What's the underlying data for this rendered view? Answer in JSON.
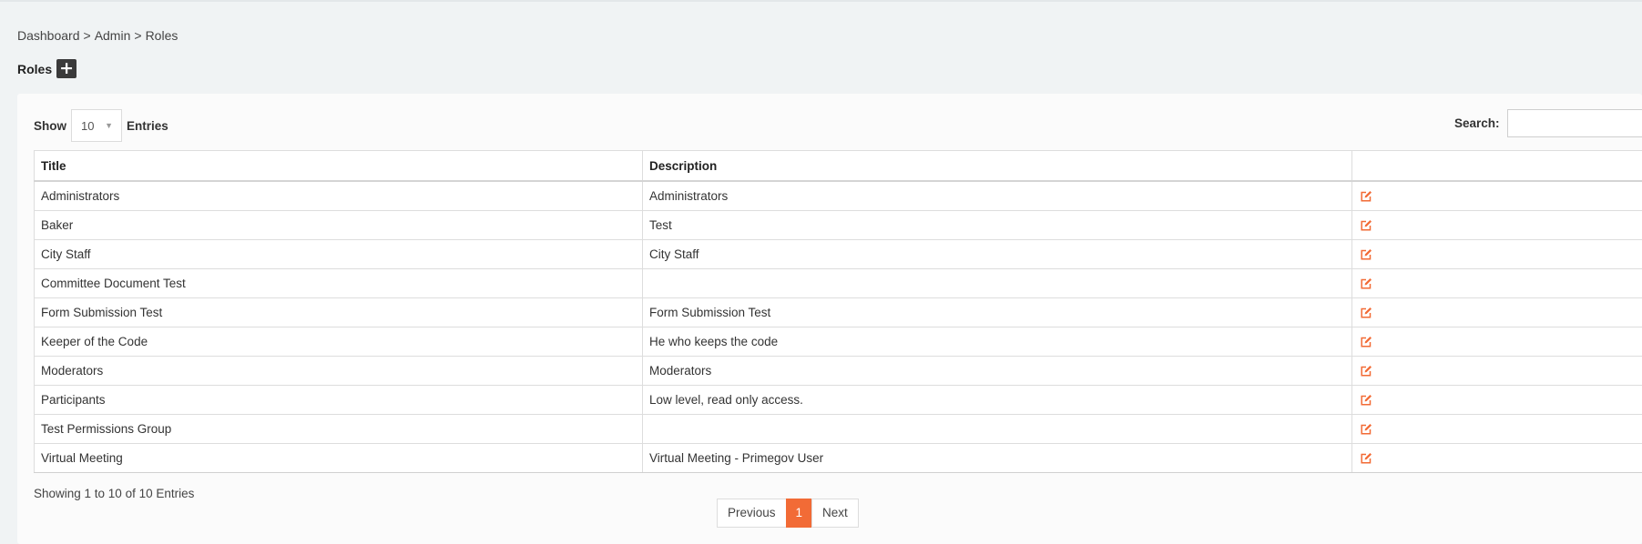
{
  "breadcrumb": {
    "items": [
      "Dashboard",
      "Admin",
      "Roles"
    ],
    "separator": ">"
  },
  "page": {
    "title": "Roles",
    "add_button_label": "+"
  },
  "table_controls": {
    "show_label": "Show",
    "entries_value": "10",
    "entries_label": "Entries",
    "search_label": "Search:",
    "search_value": ""
  },
  "table": {
    "columns": [
      "Title",
      "Description",
      ""
    ],
    "rows": [
      {
        "title": "Administrators",
        "description": "Administrators"
      },
      {
        "title": "Baker",
        "description": "Test"
      },
      {
        "title": "City Staff",
        "description": "City Staff"
      },
      {
        "title": "Committee Document Test",
        "description": ""
      },
      {
        "title": "Form Submission Test",
        "description": "Form Submission Test"
      },
      {
        "title": "Keeper of the Code",
        "description": "He who keeps the code"
      },
      {
        "title": "Moderators",
        "description": "Moderators"
      },
      {
        "title": "Participants",
        "description": "Low level, read only access."
      },
      {
        "title": "Test Permissions Group",
        "description": ""
      },
      {
        "title": "Virtual Meeting",
        "description": "Virtual Meeting - Primegov User"
      }
    ],
    "row_action_icon": "edit-icon"
  },
  "footer": {
    "info": "Showing 1 to 10 of 10 Entries",
    "pagination": {
      "previous_label": "Previous",
      "current_page": "1",
      "next_label": "Next"
    }
  },
  "colors": {
    "accent": "#f26b36",
    "page_bg": "#f0f3f4",
    "panel_bg": "#fbfbfb",
    "add_button_bg": "#3a3a3a"
  }
}
